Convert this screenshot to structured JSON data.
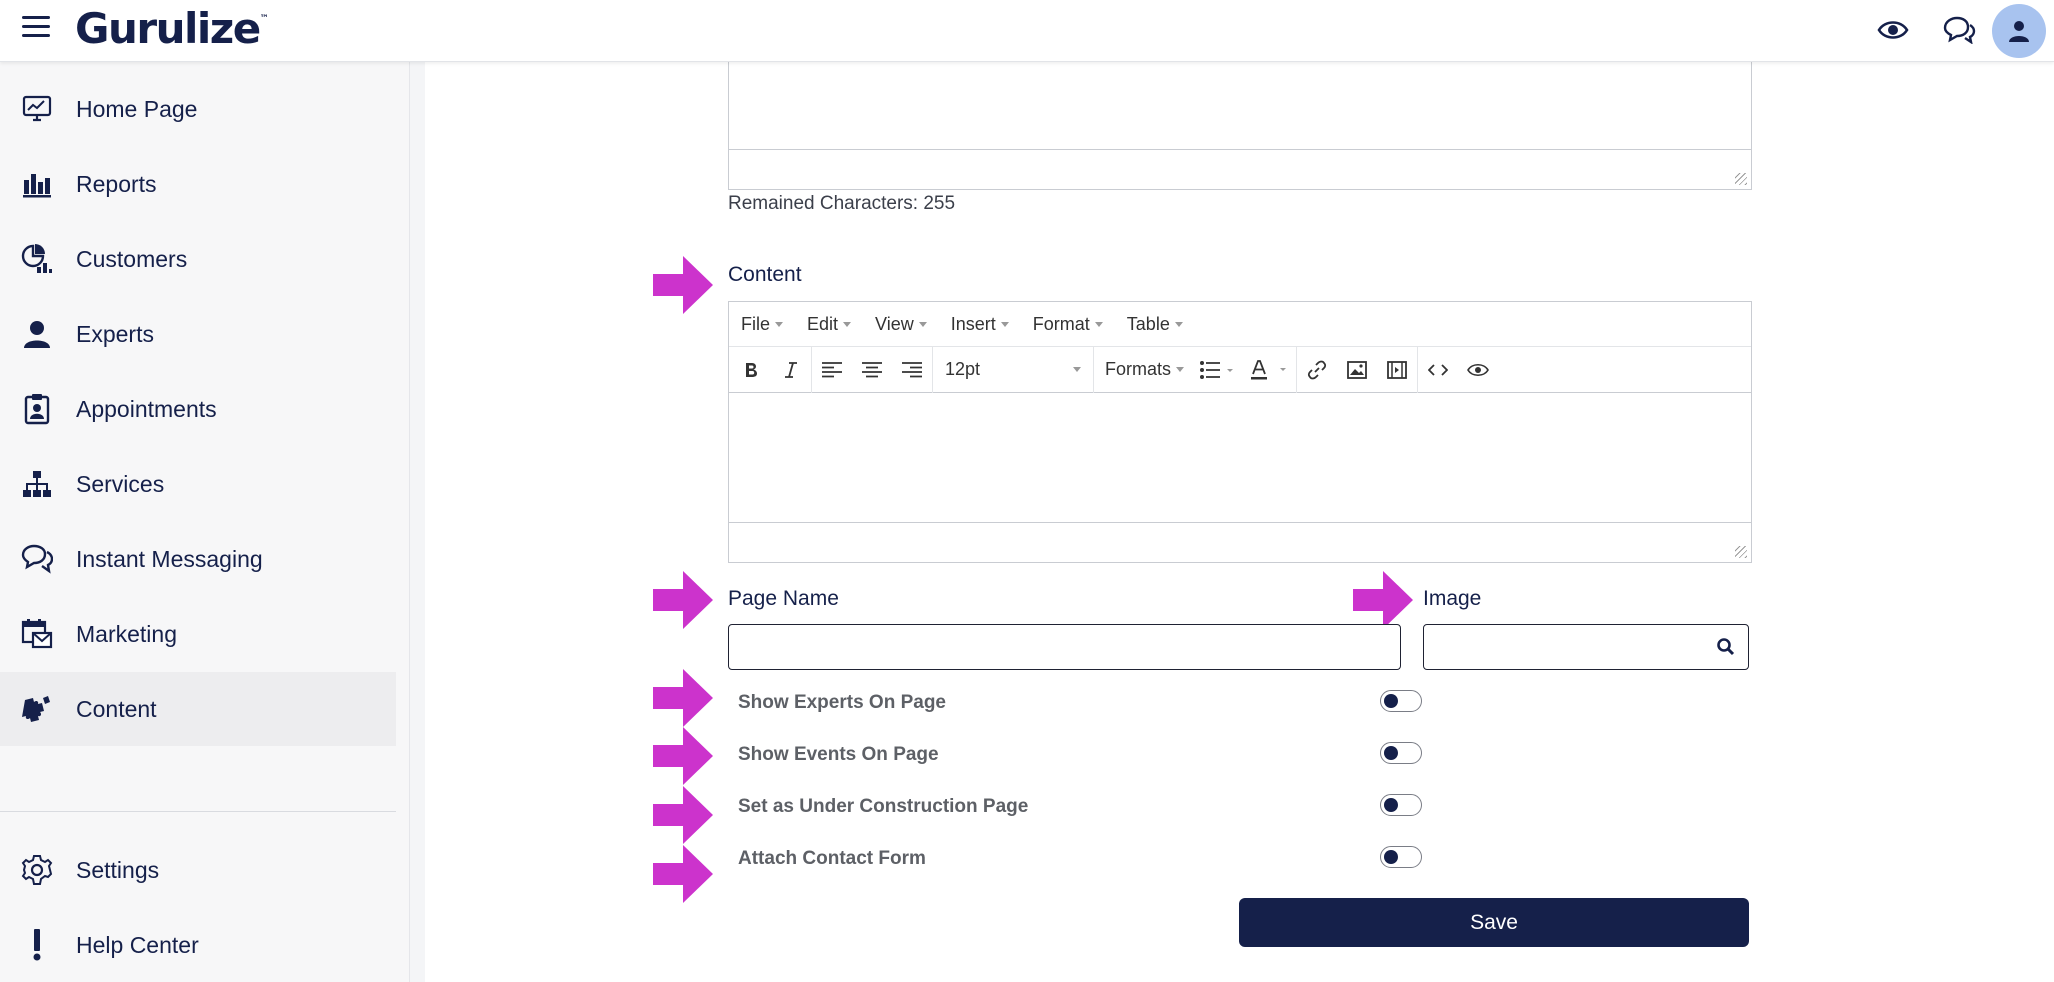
{
  "app": {
    "logo": "Gurulize",
    "logo_tm": "™"
  },
  "topbar": {
    "icons": [
      "menu-icon",
      "eye-icon",
      "chat-icon",
      "user-avatar-icon"
    ]
  },
  "sidebar": {
    "items": [
      {
        "label": "Home Page",
        "icon": "monitor-chart-icon"
      },
      {
        "label": "Reports",
        "icon": "bar-chart-icon"
      },
      {
        "label": "Customers",
        "icon": "pie-chart-icon"
      },
      {
        "label": "Experts",
        "icon": "person-icon"
      },
      {
        "label": "Appointments",
        "icon": "badge-icon"
      },
      {
        "label": "Services",
        "icon": "hierarchy-icon"
      },
      {
        "label": "Instant Messaging",
        "icon": "chat-bubbles-icon"
      },
      {
        "label": "Marketing",
        "icon": "calendar-mail-icon"
      },
      {
        "label": "Content",
        "icon": "puzzle-icon",
        "active": true
      }
    ],
    "bottom_items": [
      {
        "label": "Settings",
        "icon": "gear-icon"
      },
      {
        "label": "Help Center",
        "icon": "exclamation-icon"
      }
    ]
  },
  "form": {
    "remaining_characters": "Remained Characters: 255",
    "content_label": "Content",
    "editor": {
      "menus": [
        "File",
        "Edit",
        "View",
        "Insert",
        "Format",
        "Table"
      ],
      "font_size": "12pt",
      "formats_label": "Formats",
      "toolbar_icons": [
        "bold-icon",
        "italic-icon",
        "align-left-icon",
        "align-center-icon",
        "align-right-icon",
        "bullet-list-icon",
        "text-color-icon",
        "link-icon",
        "image-icon",
        "media-icon",
        "code-icon",
        "preview-icon"
      ]
    },
    "page_name_label": "Page Name",
    "page_name_value": "",
    "image_label": "Image",
    "image_value": "",
    "toggles": [
      {
        "label": "Show Experts On Page",
        "on": false
      },
      {
        "label": "Show Events On Page",
        "on": false
      },
      {
        "label": "Set as Under Construction Page",
        "on": false
      },
      {
        "label": "Attach Contact Form",
        "on": false
      }
    ],
    "save_label": "Save"
  },
  "colors": {
    "brand_navy": "#15204a",
    "annotation_arrow": "#cc33cc",
    "avatar_bg": "#a8c3ef"
  }
}
